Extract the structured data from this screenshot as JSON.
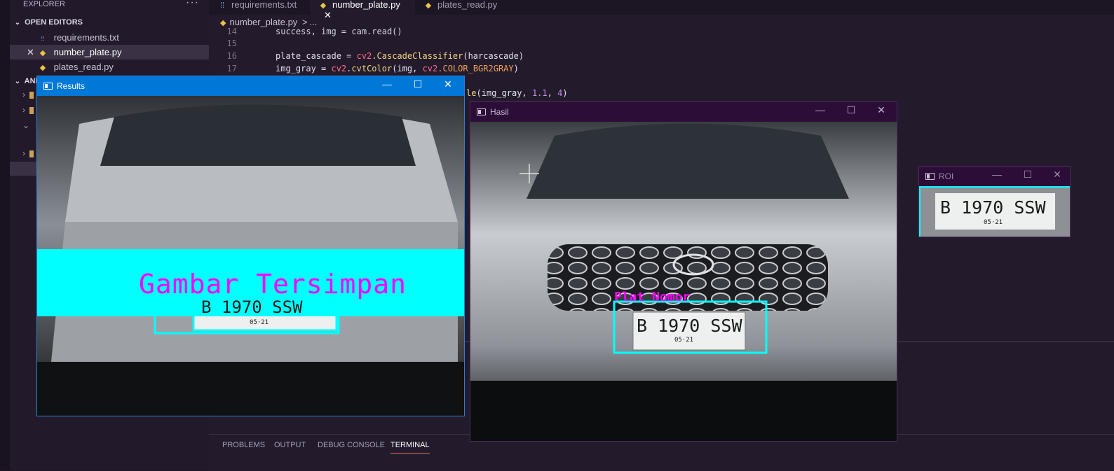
{
  "sidebar": {
    "header": "EXPLORER",
    "more_actions": "···",
    "open_editors_label": "OPEN EDITORS",
    "open_editors": [
      {
        "name": "requirements.txt",
        "icon": "info-file-icon",
        "active": false
      },
      {
        "name": "number_plate.py",
        "icon": "python-icon",
        "active": true
      },
      {
        "name": "plates_read.py",
        "icon": "python-icon",
        "active": false
      }
    ],
    "project_label": "ANF"
  },
  "tabs": [
    {
      "label": "requirements.txt",
      "icon": "info-file-icon",
      "active": false
    },
    {
      "label": "number_plate.py",
      "icon": "python-icon",
      "active": true,
      "close": "✕"
    },
    {
      "label": "plates_read.py",
      "icon": "python-icon",
      "active": false
    }
  ],
  "breadcrumb": {
    "file": "number_plate.py",
    "separator": ">",
    "rest": "..."
  },
  "code": {
    "line14": {
      "num": "14",
      "text": "success, img = cam.read()"
    },
    "line15": {
      "num": "15"
    },
    "line16": {
      "num": "16",
      "var": "plate_cascade",
      "op": " = ",
      "mod": "cv2",
      "dot": ".",
      "fn": "CascadeClassifier",
      "arg": "(harcascade)"
    },
    "line17": {
      "num": "17",
      "var": "img_gray",
      "op": " = ",
      "mod": "cv2",
      "dot": ".",
      "fn": "cvtColor",
      "arg1": "(img, ",
      "mod2": "cv2",
      "const": ".COLOR_BGR2GRAY",
      "close": ")"
    },
    "partial": {
      "fn_tail": "le",
      "open": "(",
      "arg": "img_gray, ",
      "n1": "1.1",
      "comma": ", ",
      "n2": "4",
      "close": ")"
    }
  },
  "panel": {
    "tabs": [
      "PROBLEMS",
      "OUTPUT",
      "DEBUG CONSOLE",
      "TERMINAL"
    ],
    "active": "TERMINAL"
  },
  "windows": {
    "results": {
      "title": "Results",
      "banner_text": "Gambar Tersimpan",
      "plate_main": "B 1970 SSW",
      "plate_sub": "05·21"
    },
    "hasil": {
      "title": "Hasil",
      "label": "Plat Nomor",
      "plate_main": "B 1970 SSW",
      "plate_sub": "05·21"
    },
    "roi": {
      "title": "ROI",
      "plate_main": "B 1970 SSW",
      "plate_sub": "05·21"
    },
    "buttons": {
      "minimize": "—",
      "maximize": "☐",
      "close": "✕"
    }
  },
  "colors": {
    "accent_cyan": "#00ffff",
    "accent_magenta": "#ff00ff",
    "titlebar_blue": "#0078d7",
    "titlebar_purple": "#2b0d37"
  }
}
